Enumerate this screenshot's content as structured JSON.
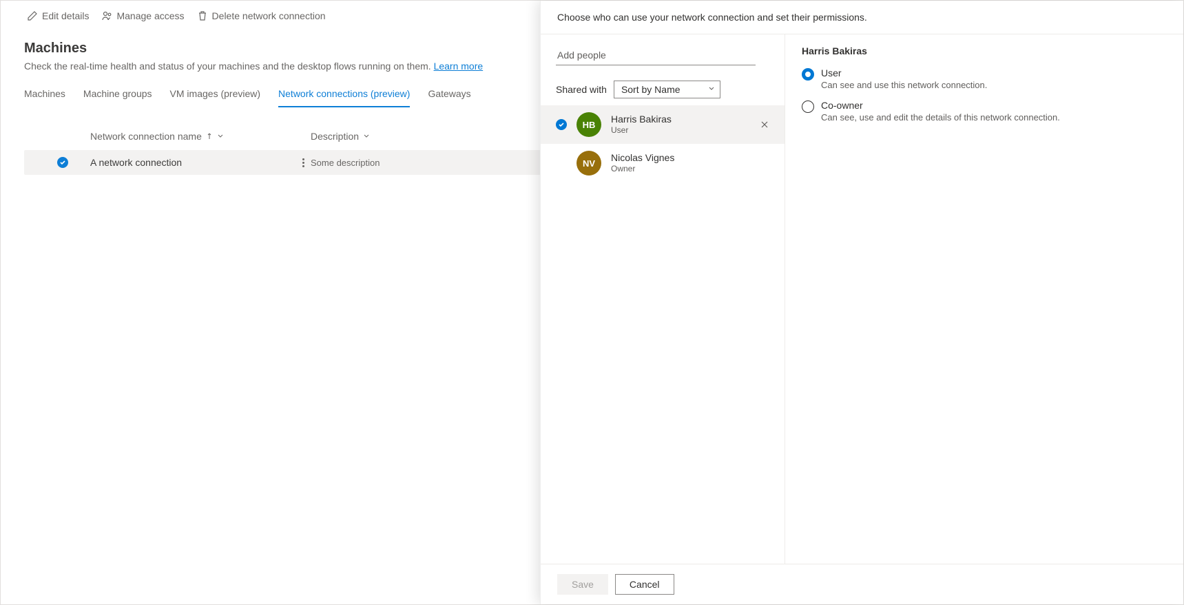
{
  "commandbar": {
    "edit": "Edit details",
    "access": "Manage access",
    "delete": "Delete network connection"
  },
  "page": {
    "title": "Machines",
    "subtitle": "Check the real-time health and status of your machines and the desktop flows running on them.",
    "learn_more": "Learn more"
  },
  "tabs": {
    "machines": "Machines",
    "groups": "Machine groups",
    "images": "VM images (preview)",
    "netconn": "Network connections (preview)",
    "gateways": "Gateways"
  },
  "columns": {
    "name": "Network connection name",
    "desc": "Description"
  },
  "row": {
    "name": "A network connection",
    "desc": "Some description"
  },
  "panel": {
    "header": "Choose who can use your network connection and set their permissions.",
    "add_placeholder": "Add people",
    "shared_label": "Shared with",
    "sort_value": "Sort by Name",
    "people": [
      {
        "initials": "HB",
        "name": "Harris Bakiras",
        "role": "User",
        "color": "green",
        "selected": true
      },
      {
        "initials": "NV",
        "name": "Nicolas Vignes",
        "role": "Owner",
        "color": "gold",
        "selected": false
      }
    ],
    "detail_name": "Harris Bakiras",
    "perm_user_title": "User",
    "perm_user_desc": "Can see and use this network connection.",
    "perm_coowner_title": "Co-owner",
    "perm_coowner_desc": "Can see, use and edit the details of this network connection.",
    "save": "Save",
    "cancel": "Cancel"
  }
}
